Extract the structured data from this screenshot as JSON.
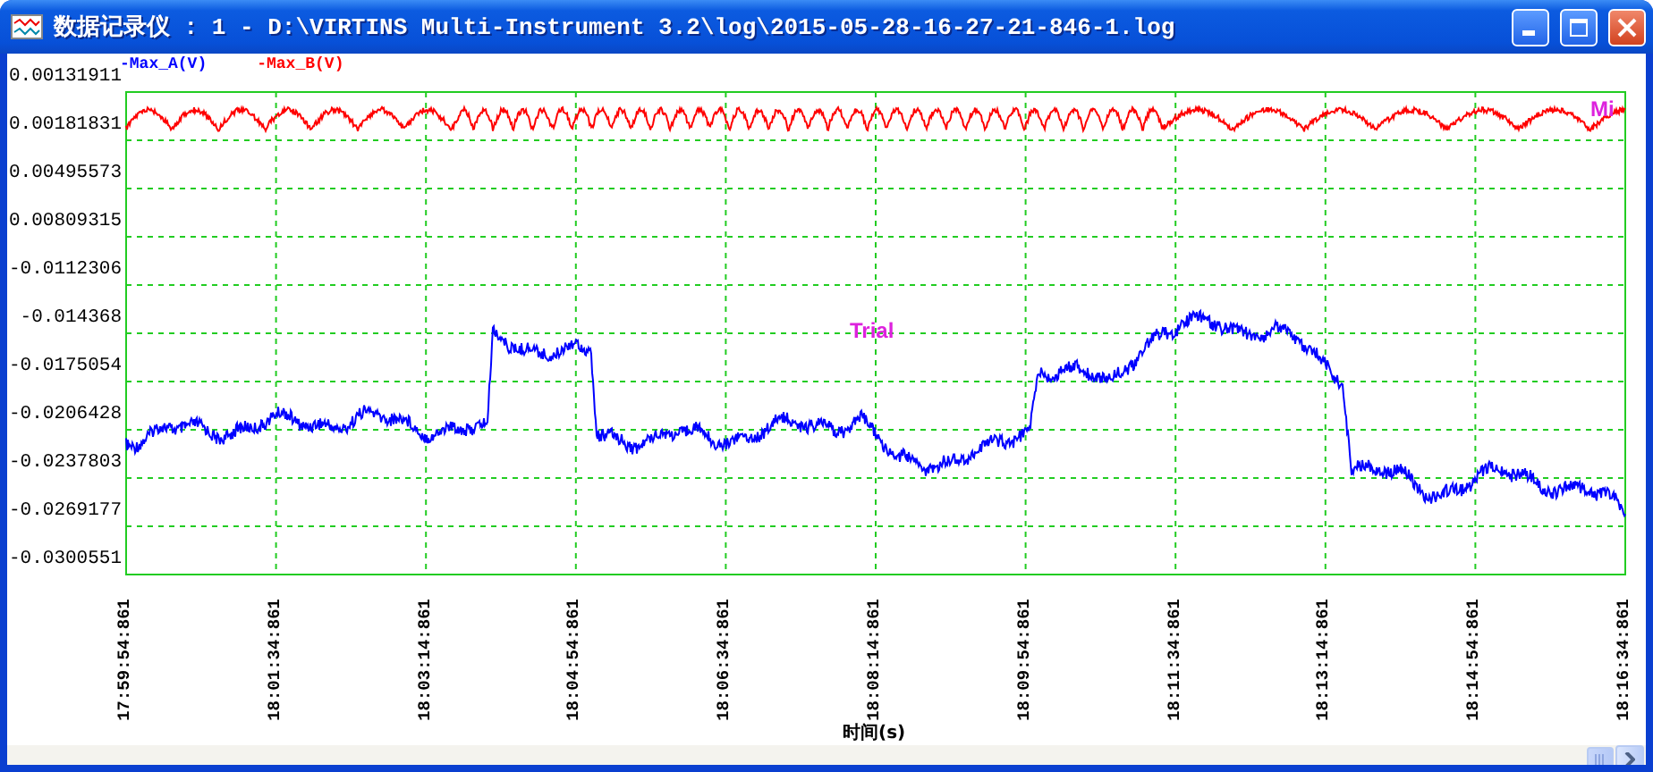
{
  "window": {
    "title": "数据记录仪 : 1 - D:\\VIRTINS Multi-Instrument 3.2\\log\\2015-05-28-16-27-21-846-1.log"
  },
  "legend": [
    {
      "label": "-Max_A(V)",
      "color": "#0000ff"
    },
    {
      "label": "-Max_B(V)",
      "color": "#ff0000"
    }
  ],
  "plot": {
    "y_ticks": [
      "0.00131911",
      "0.00181831",
      "0.00495573",
      "0.00809315",
      "-0.0112306",
      "-0.014368",
      "-0.0175054",
      "-0.0206428",
      "-0.0237803",
      "-0.0269177",
      "-0.0300551"
    ],
    "x_ticks": [
      "17:59:54:861",
      "18:01:34:861",
      "18:03:14:861",
      "18:04:54:861",
      "18:06:34:861",
      "18:08:14:861",
      "18:09:54:861",
      "18:11:34:861",
      "18:13:14:861",
      "18:14:54:861",
      "18:16:34:861"
    ],
    "x_label": "时间(s)",
    "overlay_texts": [
      "Trial",
      "Mi"
    ]
  }
}
